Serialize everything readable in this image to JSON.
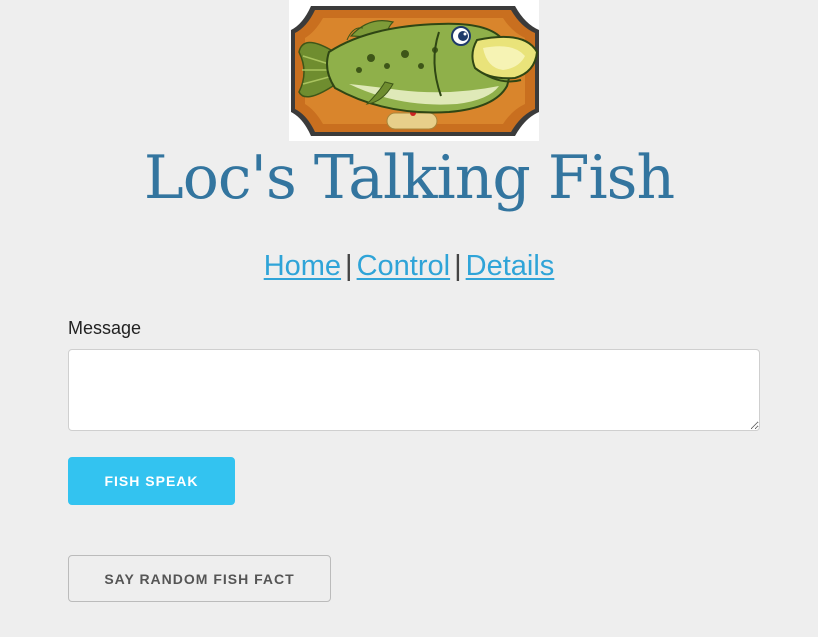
{
  "header": {
    "logo_icon": "mounted-bass-fish-icon",
    "title": "Loc's Talking Fish"
  },
  "nav": {
    "items": [
      {
        "label": "Home"
      },
      {
        "label": "Control"
      },
      {
        "label": "Details"
      }
    ],
    "separator": "|"
  },
  "form": {
    "message_label": "Message",
    "message_value": "",
    "speak_button": "FISH SPEAK",
    "random_fact_button": "SAY RANDOM FISH FACT"
  },
  "colors": {
    "background": "#eeeeee",
    "title": "#33759f",
    "link": "#2fa4d8",
    "primary_button": "#33c3f0"
  }
}
